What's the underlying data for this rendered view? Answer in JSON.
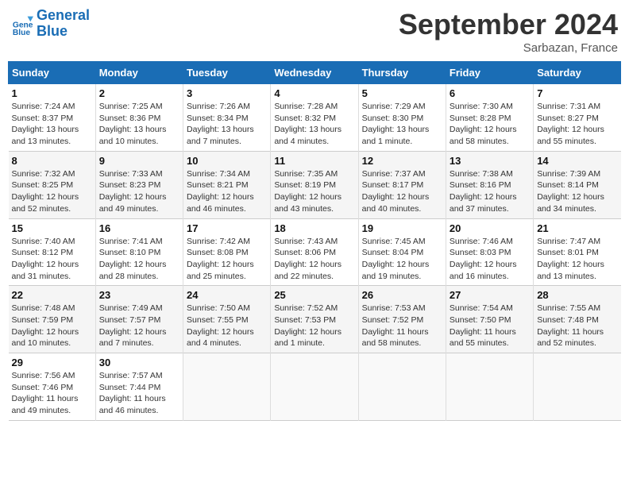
{
  "header": {
    "logo_line1": "General",
    "logo_line2": "Blue",
    "month": "September 2024",
    "location": "Sarbazan, France"
  },
  "weekdays": [
    "Sunday",
    "Monday",
    "Tuesday",
    "Wednesday",
    "Thursday",
    "Friday",
    "Saturday"
  ],
  "weeks": [
    [
      {
        "day": "1",
        "detail": "Sunrise: 7:24 AM\nSunset: 8:37 PM\nDaylight: 13 hours\nand 13 minutes."
      },
      {
        "day": "2",
        "detail": "Sunrise: 7:25 AM\nSunset: 8:36 PM\nDaylight: 13 hours\nand 10 minutes."
      },
      {
        "day": "3",
        "detail": "Sunrise: 7:26 AM\nSunset: 8:34 PM\nDaylight: 13 hours\nand 7 minutes."
      },
      {
        "day": "4",
        "detail": "Sunrise: 7:28 AM\nSunset: 8:32 PM\nDaylight: 13 hours\nand 4 minutes."
      },
      {
        "day": "5",
        "detail": "Sunrise: 7:29 AM\nSunset: 8:30 PM\nDaylight: 13 hours\nand 1 minute."
      },
      {
        "day": "6",
        "detail": "Sunrise: 7:30 AM\nSunset: 8:28 PM\nDaylight: 12 hours\nand 58 minutes."
      },
      {
        "day": "7",
        "detail": "Sunrise: 7:31 AM\nSunset: 8:27 PM\nDaylight: 12 hours\nand 55 minutes."
      }
    ],
    [
      {
        "day": "8",
        "detail": "Sunrise: 7:32 AM\nSunset: 8:25 PM\nDaylight: 12 hours\nand 52 minutes."
      },
      {
        "day": "9",
        "detail": "Sunrise: 7:33 AM\nSunset: 8:23 PM\nDaylight: 12 hours\nand 49 minutes."
      },
      {
        "day": "10",
        "detail": "Sunrise: 7:34 AM\nSunset: 8:21 PM\nDaylight: 12 hours\nand 46 minutes."
      },
      {
        "day": "11",
        "detail": "Sunrise: 7:35 AM\nSunset: 8:19 PM\nDaylight: 12 hours\nand 43 minutes."
      },
      {
        "day": "12",
        "detail": "Sunrise: 7:37 AM\nSunset: 8:17 PM\nDaylight: 12 hours\nand 40 minutes."
      },
      {
        "day": "13",
        "detail": "Sunrise: 7:38 AM\nSunset: 8:16 PM\nDaylight: 12 hours\nand 37 minutes."
      },
      {
        "day": "14",
        "detail": "Sunrise: 7:39 AM\nSunset: 8:14 PM\nDaylight: 12 hours\nand 34 minutes."
      }
    ],
    [
      {
        "day": "15",
        "detail": "Sunrise: 7:40 AM\nSunset: 8:12 PM\nDaylight: 12 hours\nand 31 minutes."
      },
      {
        "day": "16",
        "detail": "Sunrise: 7:41 AM\nSunset: 8:10 PM\nDaylight: 12 hours\nand 28 minutes."
      },
      {
        "day": "17",
        "detail": "Sunrise: 7:42 AM\nSunset: 8:08 PM\nDaylight: 12 hours\nand 25 minutes."
      },
      {
        "day": "18",
        "detail": "Sunrise: 7:43 AM\nSunset: 8:06 PM\nDaylight: 12 hours\nand 22 minutes."
      },
      {
        "day": "19",
        "detail": "Sunrise: 7:45 AM\nSunset: 8:04 PM\nDaylight: 12 hours\nand 19 minutes."
      },
      {
        "day": "20",
        "detail": "Sunrise: 7:46 AM\nSunset: 8:03 PM\nDaylight: 12 hours\nand 16 minutes."
      },
      {
        "day": "21",
        "detail": "Sunrise: 7:47 AM\nSunset: 8:01 PM\nDaylight: 12 hours\nand 13 minutes."
      }
    ],
    [
      {
        "day": "22",
        "detail": "Sunrise: 7:48 AM\nSunset: 7:59 PM\nDaylight: 12 hours\nand 10 minutes."
      },
      {
        "day": "23",
        "detail": "Sunrise: 7:49 AM\nSunset: 7:57 PM\nDaylight: 12 hours\nand 7 minutes."
      },
      {
        "day": "24",
        "detail": "Sunrise: 7:50 AM\nSunset: 7:55 PM\nDaylight: 12 hours\nand 4 minutes."
      },
      {
        "day": "25",
        "detail": "Sunrise: 7:52 AM\nSunset: 7:53 PM\nDaylight: 12 hours\nand 1 minute."
      },
      {
        "day": "26",
        "detail": "Sunrise: 7:53 AM\nSunset: 7:52 PM\nDaylight: 11 hours\nand 58 minutes."
      },
      {
        "day": "27",
        "detail": "Sunrise: 7:54 AM\nSunset: 7:50 PM\nDaylight: 11 hours\nand 55 minutes."
      },
      {
        "day": "28",
        "detail": "Sunrise: 7:55 AM\nSunset: 7:48 PM\nDaylight: 11 hours\nand 52 minutes."
      }
    ],
    [
      {
        "day": "29",
        "detail": "Sunrise: 7:56 AM\nSunset: 7:46 PM\nDaylight: 11 hours\nand 49 minutes."
      },
      {
        "day": "30",
        "detail": "Sunrise: 7:57 AM\nSunset: 7:44 PM\nDaylight: 11 hours\nand 46 minutes."
      },
      {
        "day": "",
        "detail": ""
      },
      {
        "day": "",
        "detail": ""
      },
      {
        "day": "",
        "detail": ""
      },
      {
        "day": "",
        "detail": ""
      },
      {
        "day": "",
        "detail": ""
      }
    ]
  ]
}
